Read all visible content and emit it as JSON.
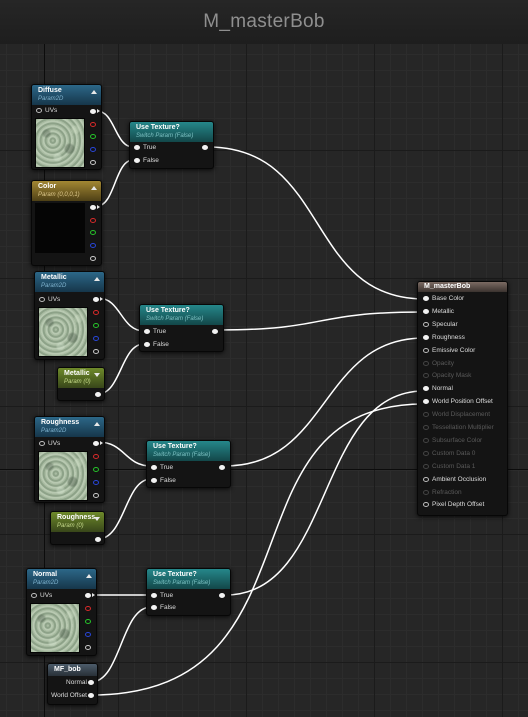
{
  "window": {
    "title": "M_masterBob"
  },
  "colors": {
    "wire": "#ffffff",
    "background": "#262626",
    "pin_red": "#d72a2a",
    "pin_green": "#26c32a",
    "pin_blue": "#2846d9"
  },
  "nodes": {
    "diffuse": {
      "title": "Diffuse",
      "subtitle": "Param2D",
      "input_label": "UVs"
    },
    "color": {
      "title": "Color",
      "subtitle": "Param (0,0,0,1)"
    },
    "metallic_tex": {
      "title": "Metallic",
      "subtitle": "Param2D",
      "input_label": "UVs"
    },
    "metallic_param": {
      "title": "Metallic",
      "subtitle": "Param (0)"
    },
    "roughness_tex": {
      "title": "Roughness",
      "subtitle": "Param2D",
      "input_label": "UVs"
    },
    "roughness_param": {
      "title": "Roughness",
      "subtitle": "Param (0)"
    },
    "normal_tex": {
      "title": "Normal",
      "subtitle": "Param2D",
      "input_label": "UVs"
    },
    "mf_bob": {
      "title": "MF_bob",
      "outputs": [
        "Normal",
        "World Offset"
      ]
    },
    "switch_1": {
      "title": "Use Texture?",
      "subtitle": "Switch Param (False)",
      "true_label": "True",
      "false_label": "False"
    },
    "switch_2": {
      "title": "Use Texture?",
      "subtitle": "Switch Param (False)",
      "true_label": "True",
      "false_label": "False"
    },
    "switch_3": {
      "title": "Use Texture?",
      "subtitle": "Switch Param (False)",
      "true_label": "True",
      "false_label": "False"
    },
    "switch_4": {
      "title": "Use Texture?",
      "subtitle": "Switch Param (False)",
      "true_label": "True",
      "false_label": "False"
    },
    "master": {
      "title": "M_masterBob",
      "inputs": [
        {
          "label": "Base Color",
          "enabled": true
        },
        {
          "label": "Metallic",
          "enabled": true
        },
        {
          "label": "Specular",
          "enabled": true
        },
        {
          "label": "Roughness",
          "enabled": true
        },
        {
          "label": "Emissive Color",
          "enabled": true
        },
        {
          "label": "Opacity",
          "enabled": false
        },
        {
          "label": "Opacity Mask",
          "enabled": false
        },
        {
          "label": "Normal",
          "enabled": true
        },
        {
          "label": "World Position Offset",
          "enabled": true
        },
        {
          "label": "World Displacement",
          "enabled": false
        },
        {
          "label": "Tessellation Multiplier",
          "enabled": false
        },
        {
          "label": "Subsurface Color",
          "enabled": false
        },
        {
          "label": "Custom Data 0",
          "enabled": false
        },
        {
          "label": "Custom Data 1",
          "enabled": false
        },
        {
          "label": "Ambient Occlusion",
          "enabled": true
        },
        {
          "label": "Refraction",
          "enabled": false
        },
        {
          "label": "Pixel Depth Offset",
          "enabled": true
        }
      ]
    }
  }
}
